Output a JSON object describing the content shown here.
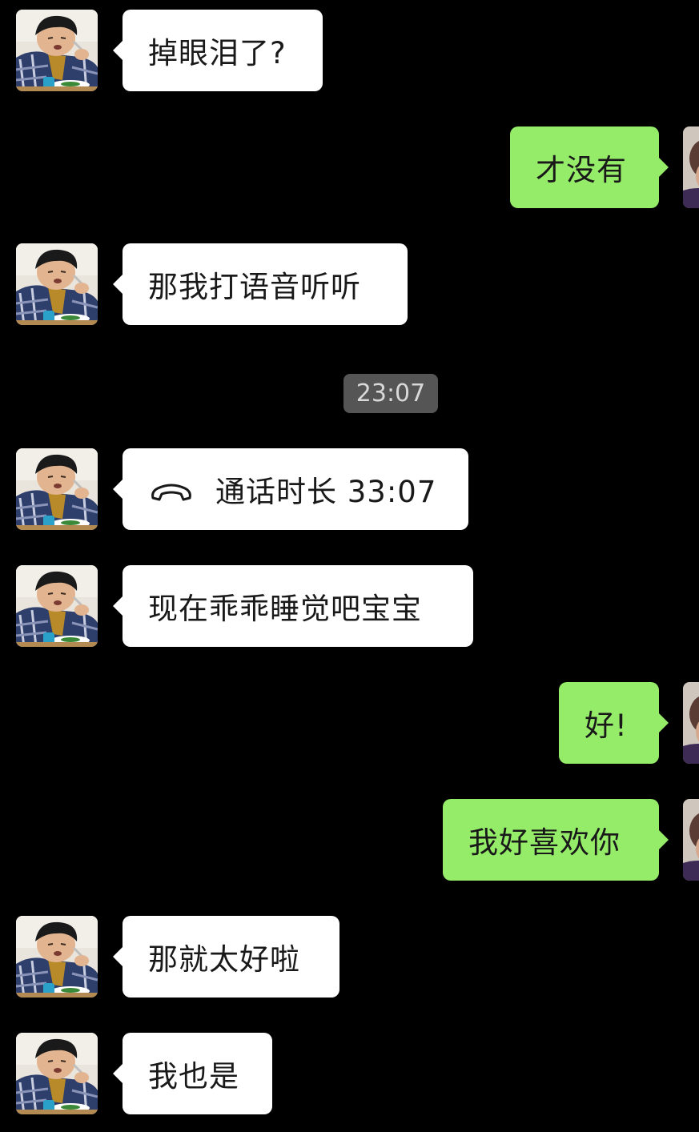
{
  "chat": {
    "messages": [
      {
        "side": "in",
        "text": "掉眼泪了?"
      },
      {
        "side": "out",
        "text": "才没有"
      },
      {
        "side": "in",
        "text": "那我打语音听听"
      },
      {
        "side": "in",
        "text": "通话时长 33:07",
        "icon": "phone-hangup-icon"
      },
      {
        "side": "in",
        "text": "现在乖乖睡觉吧宝宝"
      },
      {
        "side": "out",
        "text": "好!"
      },
      {
        "side": "out",
        "text": "我好喜欢你"
      },
      {
        "side": "in",
        "text": "那就太好啦"
      },
      {
        "side": "in",
        "text": "我也是"
      }
    ],
    "timestamp": "23:07"
  },
  "colors": {
    "background": "#000000",
    "incoming_bubble": "#ffffff",
    "outgoing_bubble": "#95ec69",
    "timestamp_bg": "#555555"
  }
}
